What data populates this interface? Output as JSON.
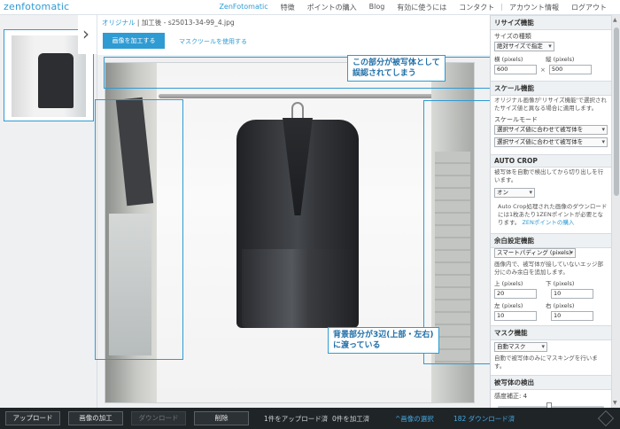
{
  "app": {
    "logo": "zenfotomatic"
  },
  "nav": {
    "items": [
      "ZenFotomatic",
      "特徴",
      "ポイントの購入",
      "Blog",
      "有効に使うには",
      "コンタクト",
      "アカウント情報",
      "ログアウト"
    ]
  },
  "breadcrumb": {
    "original": "オリジナル",
    "sep1": "|",
    "processed": "加工後",
    "sep2": "-",
    "filename": "s25013-34-99_4.jpg"
  },
  "actions": {
    "process_label": "画像を加工する",
    "mask_label": "マスクツールを使用する"
  },
  "annotations": {
    "top": "この部分が被写体として\n誤認されてしまう",
    "bottom": "背景部分が3辺(上部・左右)\nに渡っている"
  },
  "panel": {
    "resize": {
      "header": "リサイズ機能",
      "type_label": "サイズの種類",
      "type_value": "絶対サイズで指定",
      "width_label": "横 (pixels)",
      "width_value": "600",
      "height_label": "縦 (pixels)",
      "height_value": "500",
      "times": "×"
    },
    "scale": {
      "header": "スケール機能",
      "desc": "オリジナル画像が'リサイズ機能'で選択されたサイズ値と異なる場合に適用します。",
      "mode_label": "スケールモード",
      "mode_value_1": "選択サイズ値に合わせて被写体を",
      "mode_value_2": "選択サイズ値に合わせて被写体を"
    },
    "autocrop": {
      "header": "AUTO CROP",
      "desc": "被写体を自動で検出してから切り出しを行います。",
      "value": "オン",
      "note": "Auto Crop処理された画像のダウンロードには1枚あたり1ZENポイントが必要となります。",
      "note_link": "ZENポイントの購入"
    },
    "margin": {
      "header": "余白設定機能",
      "mode_value": "スマートパディング (pixels)",
      "desc": "画像内で、被写体が接していないエッジ部分にのみ余白を追加します。",
      "top_label": "上 (pixels)",
      "top_value": "20",
      "bottom_label": "下 (pixels)",
      "bottom_value": "10",
      "left_label": "左 (pixels)",
      "left_value": "10",
      "right_label": "右 (pixels)",
      "right_value": "10"
    },
    "mask": {
      "header": "マスク機能",
      "value": "自動マスク",
      "desc": "自動で被写体のみにマスキングを行います。"
    },
    "detect": {
      "header": "被写体の検出",
      "sensitivity_label": "感度補正: 4",
      "sensitivity_value": 4
    }
  },
  "bottombar": {
    "upload": "アップロード",
    "process": "画像の加工",
    "download": "ダウンロード",
    "delete": "削除",
    "uploaded": "1件をアップロード済",
    "processed": "0件を加工済",
    "select": "^画像の選択",
    "downloaded": "182 ダウンロード済"
  }
}
